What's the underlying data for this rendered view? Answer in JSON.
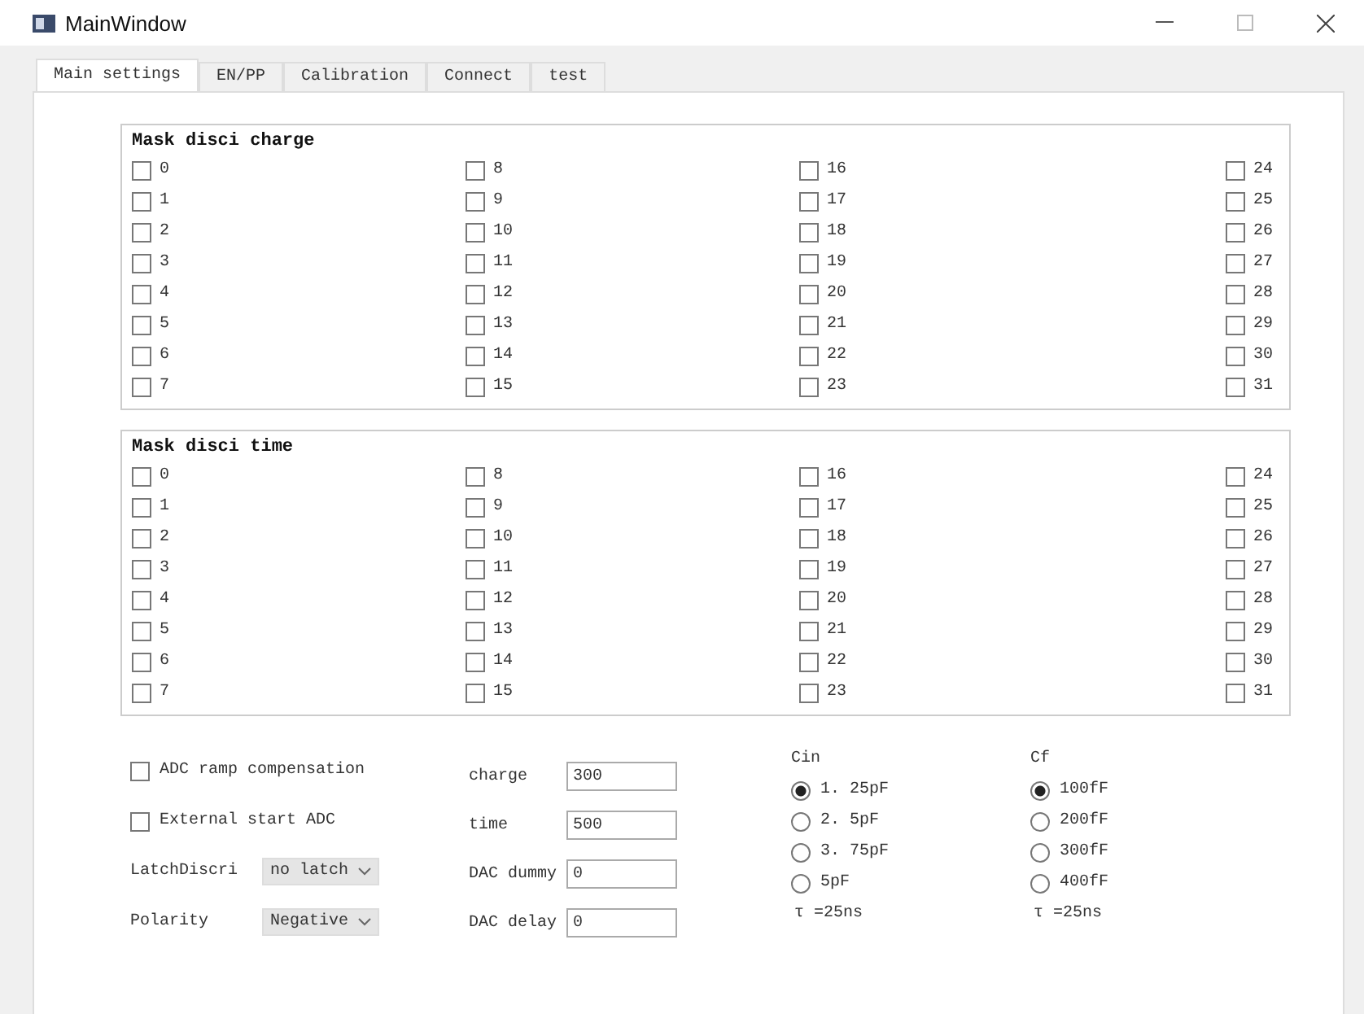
{
  "window": {
    "title": "MainWindow"
  },
  "tabs": [
    {
      "label": "Main settings",
      "selected": true
    },
    {
      "label": "EN/PP",
      "selected": false
    },
    {
      "label": "Calibration",
      "selected": false
    },
    {
      "label": "Connect",
      "selected": false
    },
    {
      "label": "test",
      "selected": false
    }
  ],
  "groups": [
    {
      "title": "Mask disci charge",
      "checkboxes": [
        {
          "label": "0",
          "checked": false
        },
        {
          "label": "1",
          "checked": false
        },
        {
          "label": "2",
          "checked": false
        },
        {
          "label": "3",
          "checked": false
        },
        {
          "label": "4",
          "checked": false
        },
        {
          "label": "5",
          "checked": false
        },
        {
          "label": "6",
          "checked": false
        },
        {
          "label": "7",
          "checked": false
        },
        {
          "label": "8",
          "checked": false
        },
        {
          "label": "9",
          "checked": false
        },
        {
          "label": "10",
          "checked": false
        },
        {
          "label": "11",
          "checked": false
        },
        {
          "label": "12",
          "checked": false
        },
        {
          "label": "13",
          "checked": false
        },
        {
          "label": "14",
          "checked": false
        },
        {
          "label": "15",
          "checked": false
        },
        {
          "label": "16",
          "checked": false
        },
        {
          "label": "17",
          "checked": false
        },
        {
          "label": "18",
          "checked": false
        },
        {
          "label": "19",
          "checked": false
        },
        {
          "label": "20",
          "checked": false
        },
        {
          "label": "21",
          "checked": false
        },
        {
          "label": "22",
          "checked": false
        },
        {
          "label": "23",
          "checked": false
        },
        {
          "label": "24",
          "checked": false
        },
        {
          "label": "25",
          "checked": false
        },
        {
          "label": "26",
          "checked": false
        },
        {
          "label": "27",
          "checked": false
        },
        {
          "label": "28",
          "checked": false
        },
        {
          "label": "29",
          "checked": false
        },
        {
          "label": "30",
          "checked": false
        },
        {
          "label": "31",
          "checked": false
        }
      ]
    },
    {
      "title": "Mask disci time",
      "checkboxes": [
        {
          "label": "0",
          "checked": false
        },
        {
          "label": "1",
          "checked": false
        },
        {
          "label": "2",
          "checked": false
        },
        {
          "label": "3",
          "checked": false
        },
        {
          "label": "4",
          "checked": false
        },
        {
          "label": "5",
          "checked": false
        },
        {
          "label": "6",
          "checked": false
        },
        {
          "label": "7",
          "checked": false
        },
        {
          "label": "8",
          "checked": false
        },
        {
          "label": "9",
          "checked": false
        },
        {
          "label": "10",
          "checked": false
        },
        {
          "label": "11",
          "checked": false
        },
        {
          "label": "12",
          "checked": false
        },
        {
          "label": "13",
          "checked": false
        },
        {
          "label": "14",
          "checked": false
        },
        {
          "label": "15",
          "checked": false
        },
        {
          "label": "16",
          "checked": false
        },
        {
          "label": "17",
          "checked": false
        },
        {
          "label": "18",
          "checked": false
        },
        {
          "label": "19",
          "checked": false
        },
        {
          "label": "20",
          "checked": false
        },
        {
          "label": "21",
          "checked": false
        },
        {
          "label": "22",
          "checked": false
        },
        {
          "label": "23",
          "checked": false
        },
        {
          "label": "24",
          "checked": false
        },
        {
          "label": "25",
          "checked": false
        },
        {
          "label": "26",
          "checked": false
        },
        {
          "label": "27",
          "checked": false
        },
        {
          "label": "28",
          "checked": false
        },
        {
          "label": "29",
          "checked": false
        },
        {
          "label": "30",
          "checked": false
        },
        {
          "label": "31",
          "checked": false
        }
      ]
    }
  ],
  "options": [
    {
      "kind": "checkbox",
      "label": "ADC ramp compensation",
      "checked": false
    },
    {
      "kind": "checkbox",
      "label": "External start ADC",
      "checked": false
    },
    {
      "kind": "dropdown",
      "label": "LatchDiscri",
      "value": "no latch"
    },
    {
      "kind": "dropdown",
      "label": "Polarity",
      "value": "Negative"
    }
  ],
  "fields": [
    {
      "label": "charge",
      "value": "300"
    },
    {
      "label": "time",
      "value": "500"
    },
    {
      "label": "DAC dummy",
      "value": "0"
    },
    {
      "label": "DAC delay",
      "value": "0"
    }
  ],
  "radio_groups": [
    {
      "title": "Cin",
      "options": [
        {
          "label": "1. 25pF",
          "selected": true
        },
        {
          "label": "2. 5pF",
          "selected": false
        },
        {
          "label": "3. 75pF",
          "selected": false
        },
        {
          "label": "5pF",
          "selected": false
        }
      ],
      "note": "τ =25ns"
    },
    {
      "title": "Cf",
      "options": [
        {
          "label": "100fF",
          "selected": true
        },
        {
          "label": "200fF",
          "selected": false
        },
        {
          "label": "300fF",
          "selected": false
        },
        {
          "label": "400fF",
          "selected": false
        }
      ],
      "note": "τ =25ns"
    }
  ]
}
